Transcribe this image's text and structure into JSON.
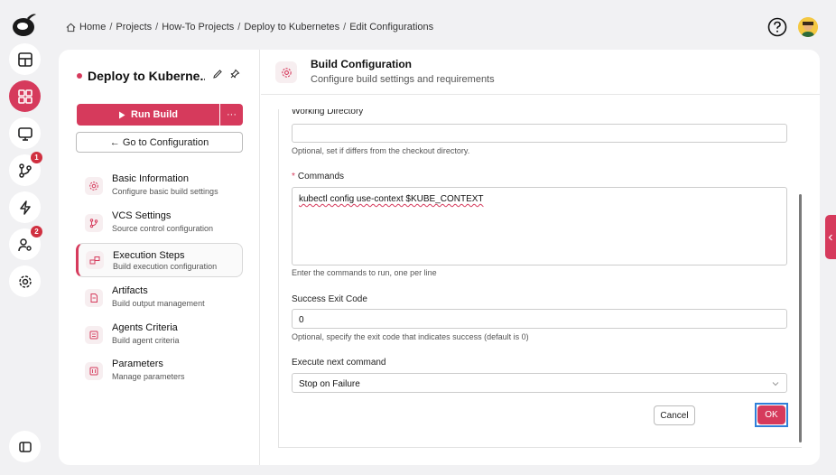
{
  "rail": {
    "items": [
      {
        "icon": "layout-icon",
        "badge": ""
      },
      {
        "icon": "grid-icon",
        "badge": "",
        "active": true
      },
      {
        "icon": "monitor-icon",
        "badge": ""
      },
      {
        "icon": "git-branch-icon",
        "badge": "1"
      },
      {
        "icon": "lightning-icon",
        "badge": ""
      },
      {
        "icon": "user-settings-icon",
        "badge": "2"
      },
      {
        "icon": "gear-icon",
        "badge": ""
      }
    ],
    "bottom_icon": "panel-toggle-icon"
  },
  "breadcrumb": [
    "Home",
    "Projects",
    "How-To Projects",
    "Deploy to Kubernetes",
    "Edit Configurations"
  ],
  "sidebar": {
    "project_title": "Deploy to Kuberne...",
    "run_button": "Run Build",
    "more_button": "···",
    "goto_button": "← Go to Configuration",
    "items": [
      {
        "title": "Basic Information",
        "subtitle": "Configure basic build settings",
        "icon": "gear-icon"
      },
      {
        "title": "VCS Settings",
        "subtitle": "Source control configuration",
        "icon": "git-branch-icon"
      },
      {
        "title": "Execution Steps",
        "subtitle": "Build execution configuration",
        "icon": "steps-icon",
        "active": true
      },
      {
        "title": "Artifacts",
        "subtitle": "Build output management",
        "icon": "file-icon"
      },
      {
        "title": "Agents Criteria",
        "subtitle": "Build agent criteria",
        "icon": "agent-icon"
      },
      {
        "title": "Parameters",
        "subtitle": "Manage parameters",
        "icon": "parameters-icon"
      }
    ]
  },
  "header": {
    "title": "Build Configuration",
    "subtitle": "Configure build settings and requirements"
  },
  "form": {
    "working_dir_label": "Working Directory",
    "working_dir_value": "",
    "working_dir_hint": "Optional, set if differs from the checkout directory.",
    "commands_label": "Commands",
    "commands_value": "kubectl config use-context $KUBE_CONTEXT",
    "commands_hint": "Enter the commands to run, one per line",
    "exit_code_label": "Success Exit Code",
    "exit_code_value": "0",
    "exit_code_hint": "Optional, specify the exit code that indicates success (default is 0)",
    "next_cmd_label": "Execute next command",
    "next_cmd_value": "Stop on Failure",
    "cancel": "Cancel",
    "ok": "OK"
  },
  "colors": {
    "accent": "#d63a5c",
    "focus": "#2f7fd8"
  }
}
